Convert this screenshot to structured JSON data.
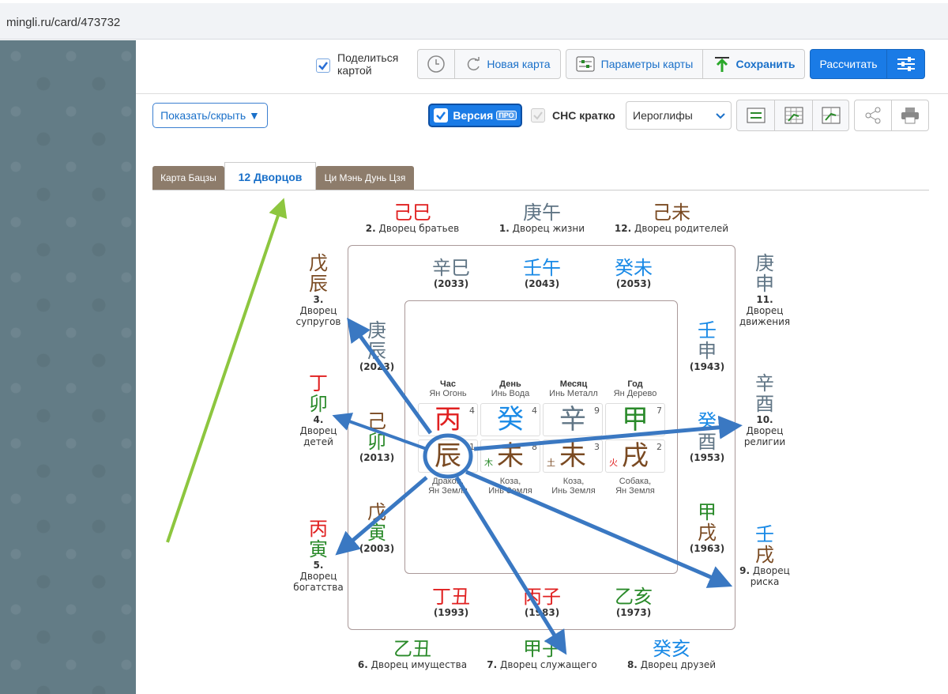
{
  "browser": {
    "url": "mingli.ru/card/473732"
  },
  "toolbar": {
    "share_label_1": "Поделиться",
    "share_label_2": "картой",
    "new_card": "Новая карта",
    "params": "Параметры карты",
    "save": "Сохранить",
    "calc": "Рассчитать",
    "showhide": "Показать/скрыть ▼",
    "version": "Версия",
    "version_badge": "ПРО",
    "snc": "СНС кратко",
    "select_value": "Иероглифы"
  },
  "tabs": [
    "Карта Бацзы",
    "12 Дворцов",
    "Ци Мэнь Дунь Цзя"
  ],
  "outer_top": [
    {
      "hz": "己巳",
      "num": "2.",
      "label": "Дворец братьев"
    },
    {
      "hz": "庚午",
      "num": "1.",
      "label": "Дворец жизни"
    },
    {
      "hz": "己未",
      "num": "12.",
      "label": "Дворец родителей"
    }
  ],
  "outer_bottom": [
    {
      "hz": "乙丑",
      "num": "6.",
      "label": "Дворец имущества"
    },
    {
      "hz": "甲子",
      "num": "7.",
      "label": "Дворец служащего"
    },
    {
      "hz": "癸亥",
      "num": "8.",
      "label": "Дворец друзей"
    }
  ],
  "outer_left": [
    {
      "hz1": "戊",
      "hz2": "辰",
      "num": "3.",
      "l1": "Дворец",
      "l2": "супругов"
    },
    {
      "hz1": "丁",
      "hz2": "卯",
      "num": "4.",
      "l1": "Дворец",
      "l2": "детей"
    },
    {
      "hz1": "丙",
      "hz2": "寅",
      "num": "5.",
      "l1": "Дворец",
      "l2": "богатства"
    }
  ],
  "outer_right": [
    {
      "hz1": "庚",
      "hz2": "申",
      "num": "11.",
      "l1": "Дворец",
      "l2": "движения"
    },
    {
      "hz1": "辛",
      "hz2": "酉",
      "num": "10.",
      "l1": "Дворец",
      "l2": "религии"
    },
    {
      "hz1": "壬",
      "hz2": "戌",
      "num": "9.",
      "l1": "Дворец",
      "l2": "риска"
    }
  ],
  "inner_top": [
    {
      "hz": "辛巳",
      "yr": "(2033)"
    },
    {
      "hz": "壬午",
      "yr": "(2043)"
    },
    {
      "hz": "癸未",
      "yr": "(2053)"
    }
  ],
  "inner_bottom": [
    {
      "hz": "丁丑",
      "yr": "(1993)"
    },
    {
      "hz": "丙子",
      "yr": "(1983)"
    },
    {
      "hz": "乙亥",
      "yr": "(1973)"
    }
  ],
  "inner_left": [
    {
      "hz1": "庚",
      "hz2": "辰",
      "yr": "(2023)"
    },
    {
      "hz1": "己",
      "hz2": "卯",
      "yr": "(2013)"
    },
    {
      "hz1": "戊",
      "hz2": "寅",
      "yr": "(2003)"
    }
  ],
  "inner_right": [
    {
      "hz1": "壬",
      "hz2": "申",
      "yr": "(1943)"
    },
    {
      "hz1": "癸",
      "hz2": "酉",
      "yr": "(1953)"
    },
    {
      "hz1": "甲",
      "hz2": "戌",
      "yr": "(1963)"
    }
  ],
  "pillars": [
    {
      "head": "Час",
      "sub": "Ян Огонь",
      "stem": "丙",
      "sn": "4",
      "branch": "辰",
      "bn": "1",
      "el": "",
      "b1": "Дракон,",
      "b2": "Ян Земля"
    },
    {
      "head": "День",
      "sub": "Инь Вода",
      "stem": "癸",
      "sn": "4",
      "branch": "未",
      "bn": "8",
      "el": "木",
      "b1": "Коза,",
      "b2": "Инь Земля"
    },
    {
      "head": "Месяц",
      "sub": "Инь Металл",
      "stem": "辛",
      "sn": "9",
      "branch": "未",
      "bn": "3",
      "el": "土",
      "b1": "Коза,",
      "b2": "Инь Земля"
    },
    {
      "head": "Год",
      "sub": "Ян Дерево",
      "stem": "甲",
      "sn": "7",
      "branch": "戌",
      "bn": "2",
      "el": "火",
      "b1": "Собака,",
      "b2": "Ян Земля"
    }
  ],
  "colors": {
    "accent": "#1a70c9",
    "calc_btn": "#1a7be6",
    "tab_gray": "#8d7c6b",
    "arrow_blue": "#3a78c2",
    "arrow_green": "#8dc63f"
  }
}
